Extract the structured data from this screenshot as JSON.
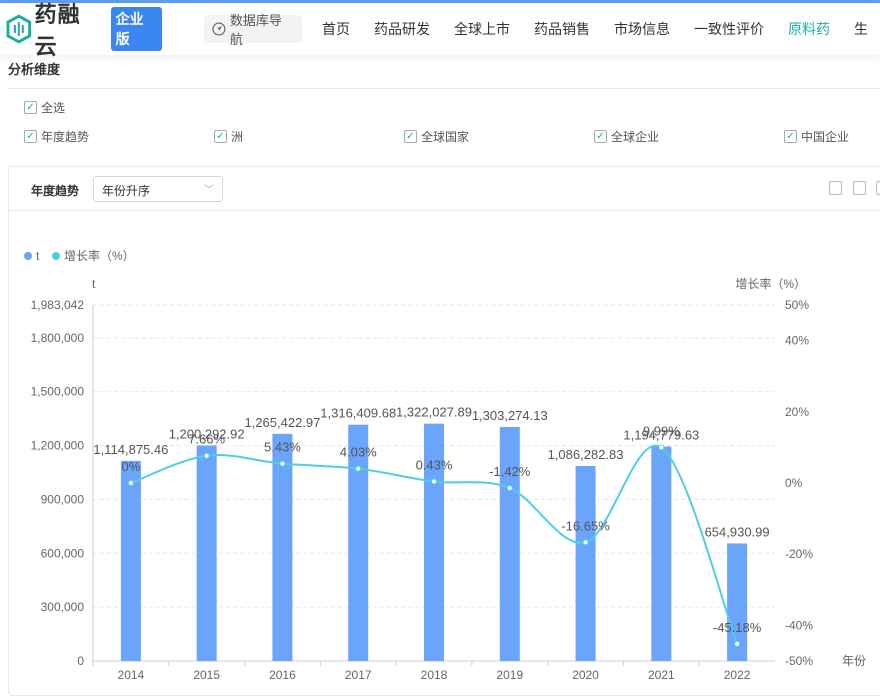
{
  "header": {
    "logo_text": "药融云",
    "badge": "企业版",
    "db_nav": "数据库导航",
    "nav": [
      "首页",
      "药品研发",
      "全球上市",
      "药品销售",
      "市场信息",
      "一致性评价",
      "原料药",
      "生"
    ],
    "active_index": 6
  },
  "analysis": {
    "title": "分析维度",
    "select_all": "全选",
    "options": [
      "年度趋势",
      "洲",
      "全球国家",
      "全球企业",
      "中国企业"
    ]
  },
  "panel": {
    "title": "年度趋势",
    "sort_value": "年份升序"
  },
  "chart_data": {
    "type": "bar+line",
    "legend": [
      "t",
      "增长率（%）"
    ],
    "legend_position": "top-left",
    "ylabel_left": "t",
    "ylabel_right": "增长率（%）",
    "xlabel": "年份",
    "categories": [
      "2014",
      "2015",
      "2016",
      "2017",
      "2018",
      "2019",
      "2020",
      "2021",
      "2022"
    ],
    "series": [
      {
        "name": "t",
        "type": "bar",
        "color": "#6aa5fb",
        "values": [
          1114875.46,
          1200292.92,
          1265422.97,
          1316409.68,
          1322027.89,
          1303274.13,
          1086282.83,
          1194779.63,
          654930.99
        ],
        "labels": [
          "1,114,875.46",
          "1,200,292.92",
          "1,265,422.97",
          "1,316,409.68",
          "1,322,027.89",
          "1,303,274.13",
          "1,086,282.83",
          "1,194,779.63",
          "654,930.99"
        ]
      },
      {
        "name": "增长率（%）",
        "type": "line",
        "color": "#4fcfdf",
        "values": [
          0,
          7.66,
          5.43,
          4.03,
          0.43,
          -1.42,
          -16.65,
          9.99,
          -45.18
        ],
        "labels": [
          "0%",
          "7.66%",
          "5.43%",
          "4.03%",
          "0.43%",
          "-1.42%",
          "-16.65%",
          "9.99%",
          "-45.18%"
        ]
      }
    ],
    "ylim_left": [
      0,
      1983042
    ],
    "yticks_left": [
      "0",
      "300,000",
      "600,000",
      "900,000",
      "1,200,000",
      "1,500,000",
      "1,800,000",
      "1,983,042"
    ],
    "ylim_right": [
      -50,
      50
    ],
    "yticks_right": [
      "-50%",
      "-40%",
      "-20%",
      "0%",
      "20%",
      "40%",
      "50%"
    ],
    "grid": true
  }
}
